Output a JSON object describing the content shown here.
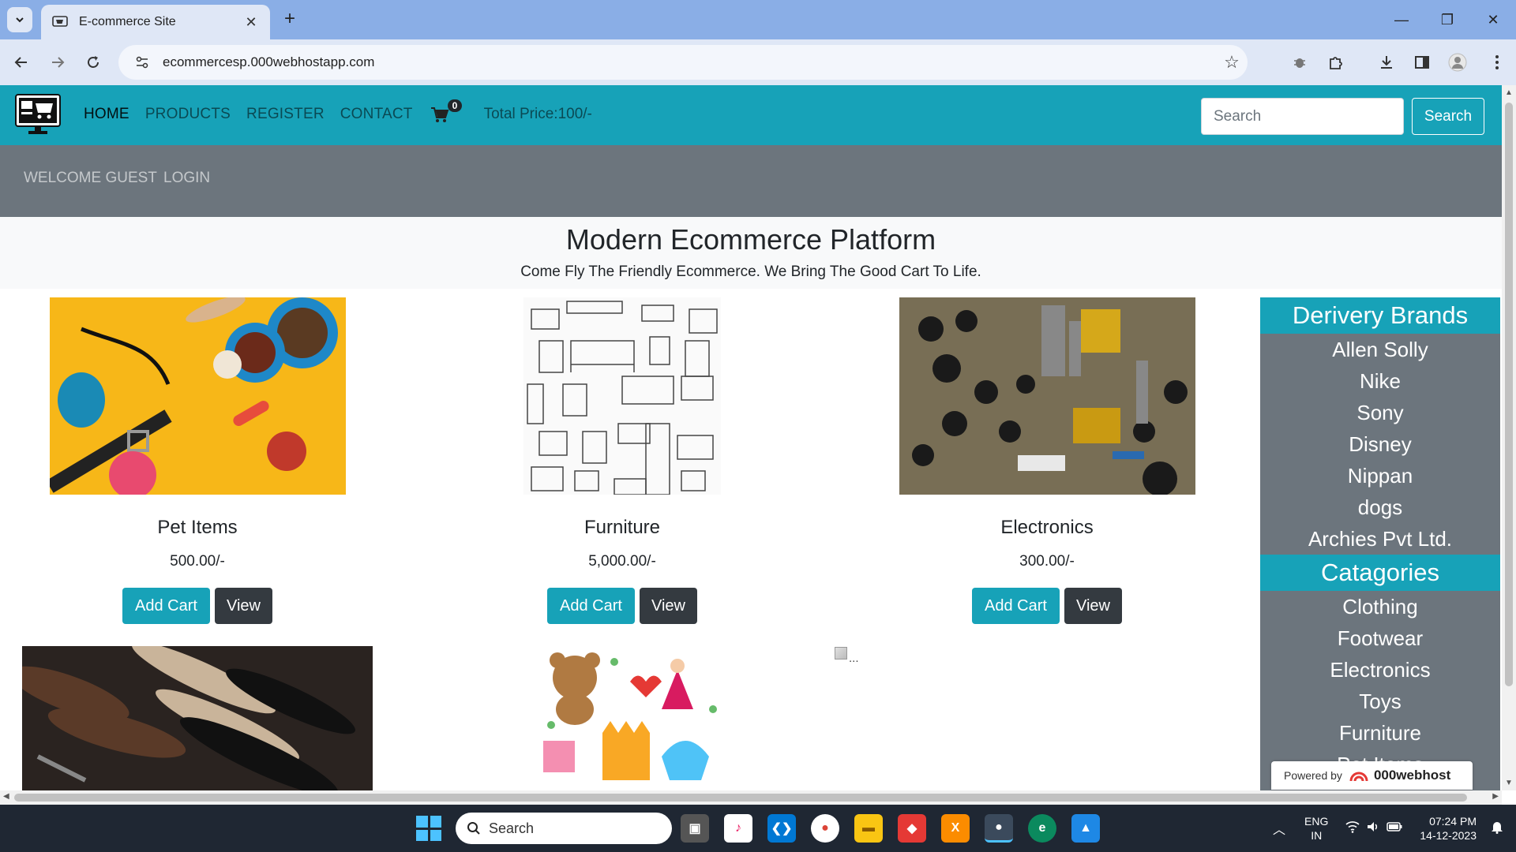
{
  "browser": {
    "tab_title": "E-commerce Site",
    "url": "ecommercesp.000webhostapp.com"
  },
  "nav": {
    "links": [
      "HOME",
      "PRODUCTS",
      "REGISTER",
      "CONTACT"
    ],
    "cart_count": "0",
    "total_price": "Total Price:100/-",
    "search_placeholder": "Search",
    "search_button": "Search"
  },
  "subnav": {
    "welcome": "WELCOME GUEST",
    "login": "LOGIN"
  },
  "hero": {
    "title": "Modern Ecommerce Platform",
    "subtitle": "Come Fly The Friendly Ecommerce. We Bring The Good Cart To Life."
  },
  "products": [
    {
      "name": "Pet Items",
      "price": "500.00/-",
      "add_label": "Add Cart",
      "view_label": "View"
    },
    {
      "name": "Furniture",
      "price": "5,000.00/-",
      "add_label": "Add Cart",
      "view_label": "View"
    },
    {
      "name": "Electronics",
      "price": "300.00/-",
      "add_label": "Add Cart",
      "view_label": "View"
    }
  ],
  "broken_image_alt": "...",
  "sidebar": {
    "brands_heading": "Derivery Brands",
    "brands": [
      "Allen Solly",
      "Nike",
      "Sony",
      "Disney",
      "Nippan",
      "dogs",
      "Archies Pvt Ltd."
    ],
    "categories_heading": "Catagories",
    "categories": [
      "Clothing",
      "Footwear",
      "Electronics",
      "Toys",
      "Furniture",
      "Pet Items"
    ]
  },
  "powered": {
    "prefix": "Powered by",
    "brand": "000webhost"
  },
  "taskbar": {
    "search_label": "Search",
    "lang_line1": "ENG",
    "lang_line2": "IN",
    "time": "07:24 PM",
    "date": "14-12-2023"
  }
}
